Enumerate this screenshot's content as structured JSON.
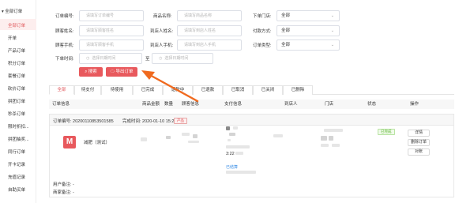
{
  "sidebar": {
    "header": "▾ 全部订单",
    "items": [
      {
        "label": "全部订单",
        "active": true
      },
      {
        "label": "开单",
        "active": false
      },
      {
        "label": "产品订单",
        "active": false
      },
      {
        "label": "积分订单",
        "active": false
      },
      {
        "label": "套餐订单",
        "active": false
      },
      {
        "label": "砍价订单",
        "active": false
      },
      {
        "label": "拼团订单",
        "active": false
      },
      {
        "label": "秒杀订单",
        "active": false
      },
      {
        "label": "限时折扣...",
        "active": false
      },
      {
        "label": "拼团抽奖...",
        "active": false
      },
      {
        "label": "同行订单",
        "active": false
      },
      {
        "label": "开卡记录",
        "active": false
      },
      {
        "label": "充值记录",
        "active": false
      },
      {
        "label": "自助买单",
        "active": false
      }
    ]
  },
  "filters": {
    "order_no": {
      "label": "订单编号:",
      "placeholder": "请填写订单编号"
    },
    "product_name": {
      "label": "商品名称:",
      "placeholder": "请填写商品名称"
    },
    "store": {
      "label": "下单门店:",
      "value": "全部"
    },
    "customer_name": {
      "label": "顾客姓名:",
      "placeholder": "请填写顾客姓名"
    },
    "arrival_name": {
      "label": "到店人姓名:",
      "placeholder": "请填写到店人姓名"
    },
    "pay_method": {
      "label": "付款方式:",
      "value": "全部"
    },
    "customer_phone": {
      "label": "顾客手机:",
      "placeholder": "请填写顾客手机"
    },
    "arrival_phone": {
      "label": "到店人手机:",
      "placeholder": "请填写到店人手机"
    },
    "order_type": {
      "label": "订单类型:",
      "value": "全部"
    },
    "order_time": {
      "label": "下单时间:",
      "start_placeholder": "选择日期时间",
      "separator": "至",
      "end_placeholder": "选择日期时间"
    },
    "search_button": "⌕ 搜索",
    "export_button": "☁ 导出订单"
  },
  "tabs": [
    "全部",
    "待支付",
    "待使用",
    "已完成",
    "退款中",
    "已退款",
    "已取消",
    "已关闭",
    "已删除"
  ],
  "table_headers": [
    "订单信息",
    "商品金额",
    "数量",
    "顾客信息",
    "支付信息",
    "到店人",
    "门店",
    "状态",
    "操作"
  ],
  "order": {
    "order_no": "订单编号: 20200110853501585",
    "complete_time": "完成时间: 2020-01-10 15:22",
    "type_tag": "产品",
    "product_name": "减肥（测试）",
    "pay_time": "3:22",
    "paid_link": "已结算",
    "status": "已完成",
    "actions": [
      "详情",
      "删除订单",
      "对账"
    ],
    "user_note": "用户备注: -",
    "merchant_note": "商家备注: -"
  },
  "colors": {
    "accent": "#e8595d",
    "status_green": "#57b32b",
    "link_blue": "#3a8ee6"
  }
}
